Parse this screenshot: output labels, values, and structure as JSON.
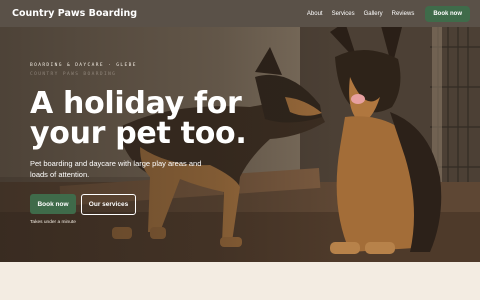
{
  "header": {
    "logo": "Country Paws Boarding",
    "nav": [
      "About",
      "Services",
      "Gallery",
      "Reviews"
    ],
    "book_label": "Book now"
  },
  "hero": {
    "eyebrow": "BOARDING & DAYCARE · GLEBE",
    "eyebrow_ghost": "COUNTRY PAWS BOARDING",
    "headline_line1": "A holiday for",
    "headline_line2": "your pet too.",
    "subtext": "Pet boarding and daycare with large play areas and loads of attention.",
    "primary_cta": "Book now",
    "secondary_cta": "Our services",
    "note": "Takes under a minute"
  },
  "colors": {
    "header_bg": "#5a5148",
    "accent_green": "#3f6b4a",
    "page_bg": "#f3ece2"
  }
}
